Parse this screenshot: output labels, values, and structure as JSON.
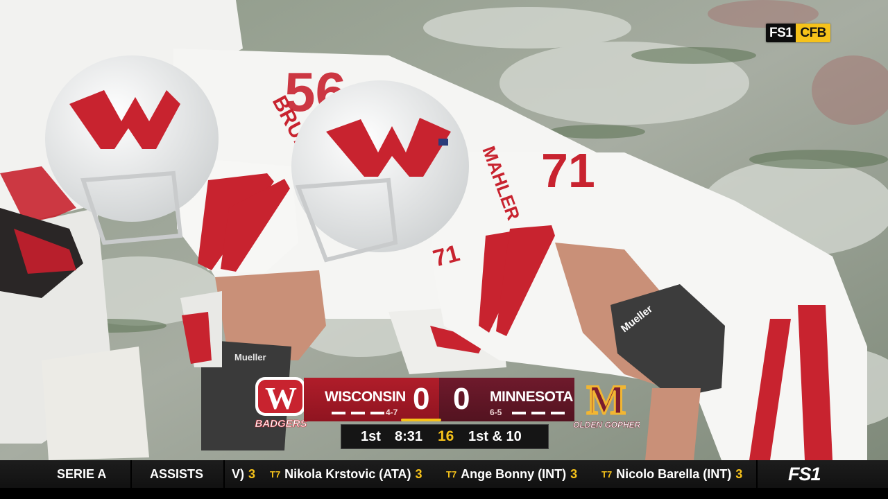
{
  "network_bug": {
    "part1": "FS1",
    "part2": "CFB"
  },
  "players": {
    "left_player": {
      "name_on_jersey": "BRUNNER",
      "number": "56"
    },
    "right_player": {
      "name_on_jersey": "MAHLER",
      "number": "71",
      "sleeve_brand": "Mueller"
    },
    "left_sleeve_brand": "Mueller"
  },
  "scorebug": {
    "away": {
      "name": "WISCONSIN",
      "record": "4-7",
      "score": "0",
      "logo_text": "BADGERS",
      "logo_letter": "W",
      "color": "#a51a27"
    },
    "home": {
      "name": "MINNESOTA",
      "record": "6-5",
      "score": "0",
      "logo_text": "GOLDEN GOPHERS",
      "logo_letter": "M",
      "color": "#6b1a2c"
    },
    "situation": {
      "quarter": "1st",
      "clock": "8:31",
      "play_clock": "16",
      "down_distance": "1st & 10"
    }
  },
  "ticker": {
    "league": "SERIE A",
    "category": "ASSISTS",
    "entries": [
      {
        "rank": "",
        "name": "V)",
        "value": "3"
      },
      {
        "rank": "T7",
        "name": "Nikola Krstovic (ATA)",
        "value": "3"
      },
      {
        "rank": "T7",
        "name": "Ange Bonny (INT)",
        "value": "3"
      },
      {
        "rank": "T7",
        "name": "Nicolo Barella (INT)",
        "value": "3"
      }
    ],
    "network": "FS1"
  }
}
